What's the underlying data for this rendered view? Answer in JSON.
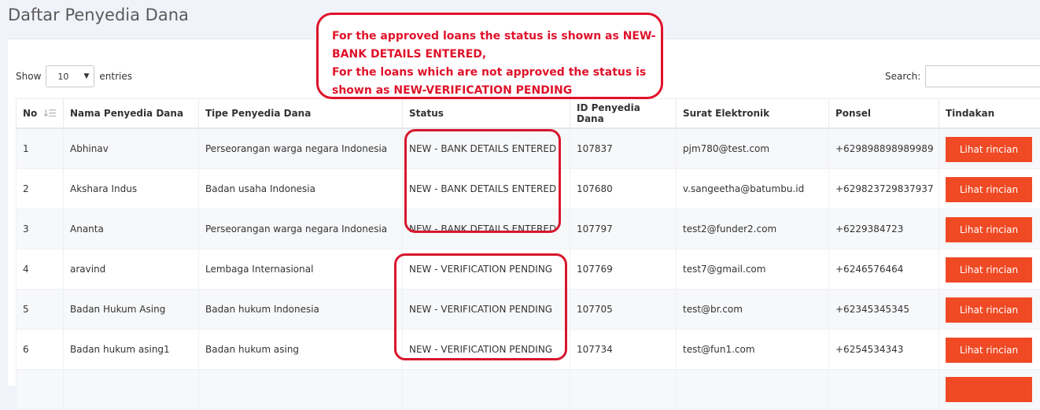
{
  "page": {
    "title": "Daftar Penyedia Dana"
  },
  "controls": {
    "show_label": "Show",
    "entries_value": "10",
    "entries_label": "entries",
    "search_label": "Search:"
  },
  "table": {
    "columns": [
      "No",
      "Nama Penyedia Dana",
      "Tipe Penyedia Dana",
      "Status",
      "ID Penyedia Dana",
      "Surat Elektronik",
      "Ponsel",
      "Tindakan"
    ],
    "rows": [
      {
        "no": "1",
        "name": "Abhinav",
        "type": "Perseorangan warga negara Indonesia",
        "status": "NEW - BANK DETAILS ENTERED",
        "id": "107837",
        "email": "pjm780@test.com",
        "phone": "+629898898989989",
        "action": "Lihat rincian"
      },
      {
        "no": "2",
        "name": "Akshara Indus",
        "type": "Badan usaha Indonesia",
        "status": "NEW - BANK DETAILS ENTERED",
        "id": "107680",
        "email": "v.sangeetha@batumbu.id",
        "phone": "+629823729837937",
        "action": "Lihat rincian"
      },
      {
        "no": "3",
        "name": "Ananta",
        "type": "Perseorangan warga negara Indonesia",
        "status": "NEW - BANK DETAILS ENTERED",
        "id": "107797",
        "email": "test2@funder2.com",
        "phone": "+6229384723",
        "action": "Lihat rincian"
      },
      {
        "no": "4",
        "name": "aravind",
        "type": "Lembaga Internasional",
        "status": "NEW - VERIFICATION PENDING",
        "id": "107769",
        "email": "test7@gmail.com",
        "phone": "+6246576464",
        "action": "Lihat rincian"
      },
      {
        "no": "5",
        "name": "Badan Hukum Asing",
        "type": "Badan hukum Indonesia",
        "status": "NEW - VERIFICATION PENDING",
        "id": "107705",
        "email": "test@br.com",
        "phone": "+62345345345",
        "action": "Lihat rincian"
      },
      {
        "no": "6",
        "name": "Badan hukum asing1",
        "type": "Badan hukum asing",
        "status": "NEW - VERIFICATION PENDING",
        "id": "107734",
        "email": "test@fun1.com",
        "phone": "+6254534343",
        "action": "Lihat rincian"
      }
    ]
  },
  "annotation": {
    "lines": [
      "For the approved loans the status is shown as NEW-",
      "BANK DETAILS ENTERED,",
      "For the loans which are not approved the status is",
      "shown as NEW-VERIFICATION PENDING"
    ]
  },
  "colors": {
    "action_button": "#ef4a24",
    "annotation": "#e0122a",
    "background": "#f1f3fa"
  },
  "icons": {
    "sort": "sort-ascending-icon",
    "select_caret": "caret-down-icon"
  }
}
